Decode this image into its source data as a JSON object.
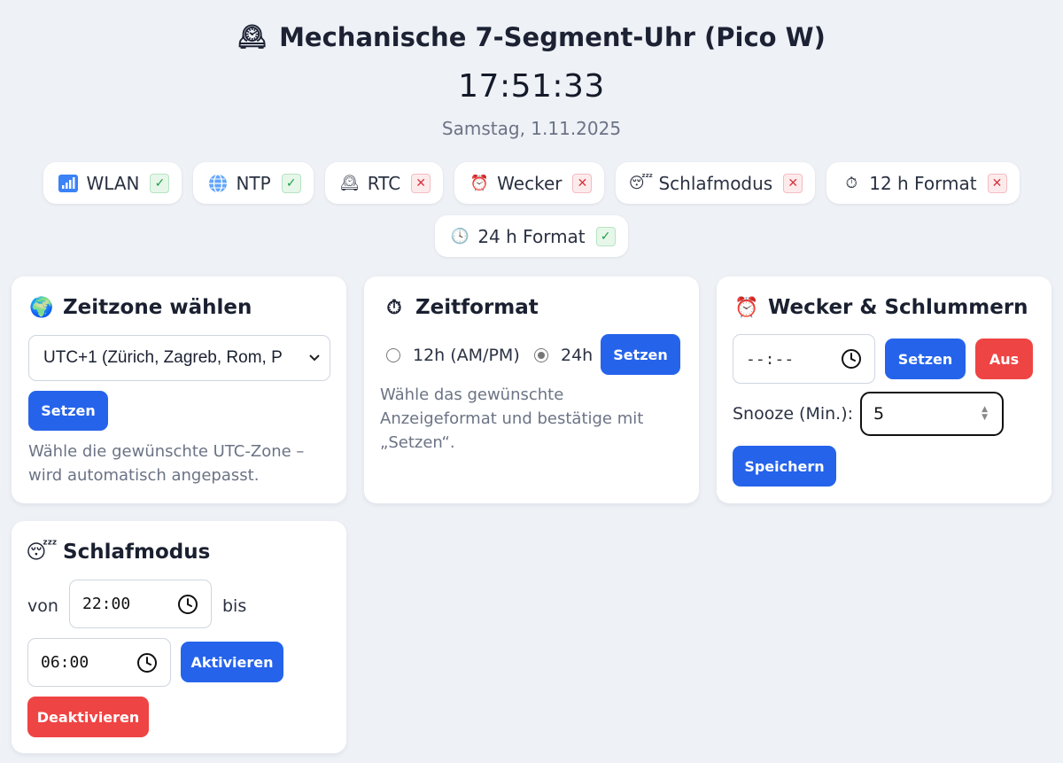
{
  "header": {
    "icon": "mantelpiece-clock-icon",
    "title": "Mechanische 7-Segment-Uhr (Pico W)",
    "time": "17:51:33",
    "date": "Samstag, 1.11.2025"
  },
  "status_chips": [
    {
      "icon": "signal-bars-icon",
      "label": "WLAN",
      "state": "✓",
      "ok": true
    },
    {
      "icon": "globe-icon",
      "label": "NTP",
      "state": "✓",
      "ok": true
    },
    {
      "icon": "mantelpiece-clock-icon",
      "label": "RTC",
      "state": "✕",
      "ok": false
    },
    {
      "icon": "alarm-clock-icon",
      "label": "Wecker",
      "state": "✕",
      "ok": false
    },
    {
      "icon": "sleeping-face-icon",
      "label": "Schlafmodus",
      "state": "✕",
      "ok": false
    },
    {
      "icon": "stopwatch-icon",
      "label": "12 h Format",
      "state": "✕",
      "ok": false
    },
    {
      "icon": "clock-icon",
      "label": "24 h Format",
      "state": "✓",
      "ok": true
    }
  ],
  "timezone": {
    "title": "Zeitzone wählen",
    "icon": "globe-europe-icon",
    "selected": "UTC+1 (Zürich, Zagreb, Rom, P",
    "button": "Setzen",
    "help": "Wähle die gewünschte UTC-Zone – wird automatisch angepasst."
  },
  "timeformat": {
    "title": "Zeitformat",
    "icon": "stopwatch-icon",
    "option_12": "12h (AM/PM)",
    "option_24": "24h",
    "selected": "24h",
    "button": "Setzen",
    "help": "Wähle das gewünschte Anzeigeformat und bestätige mit „Setzen“."
  },
  "alarm": {
    "title": "Wecker & Schlummern",
    "icon": "alarm-clock-icon",
    "time_value": "--:--",
    "set_button": "Setzen",
    "off_button": "Aus",
    "snooze_label": "Snooze (Min.):",
    "snooze_value": "5",
    "save_button": "Speichern"
  },
  "sleep": {
    "title": "Schlafmodus",
    "icon": "sleeping-face-icon",
    "from_label": "von",
    "from_value": "22:00",
    "to_label": "bis",
    "to_value": "06:00",
    "activate_button": "Aktivieren",
    "deactivate_button": "Deaktivieren"
  },
  "colors": {
    "primary": "#2563eb",
    "danger": "#ef4444",
    "background": "#eef1f6"
  }
}
